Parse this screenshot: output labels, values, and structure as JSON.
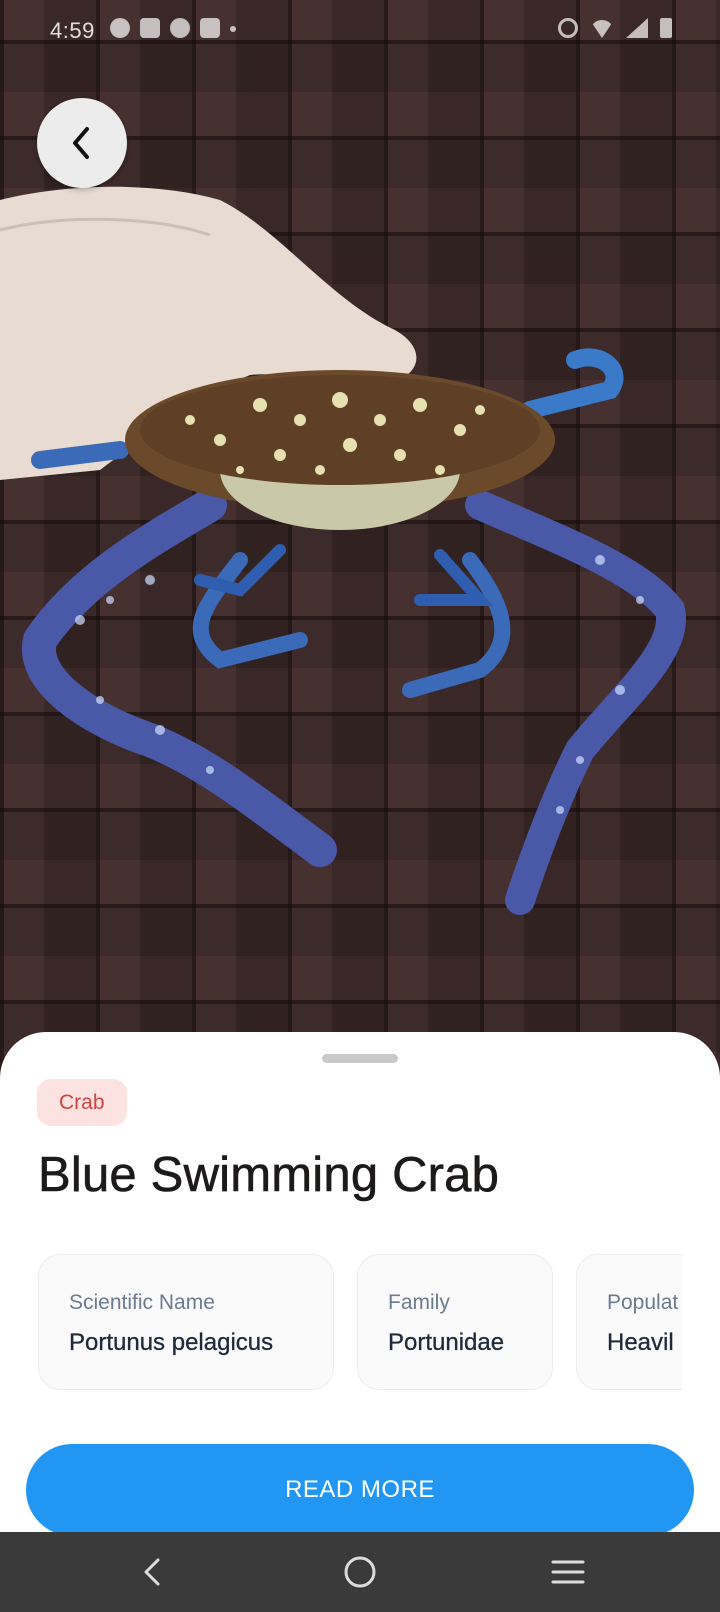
{
  "status_bar": {
    "time": "4:59"
  },
  "photo": {
    "subject": "blue swimming crab held in hand over tiled floor"
  },
  "back_button": {
    "icon": "chevron-left-icon"
  },
  "sheet": {
    "category_chip": "Crab",
    "title": "Blue Swimming Crab",
    "info_cards": [
      {
        "label": "Scientific Name",
        "value": "Portunus pelagicus"
      },
      {
        "label": "Family",
        "value": "Portunidae"
      },
      {
        "label": "Populat",
        "value": "Heavil"
      }
    ],
    "read_more_label": "READ MORE"
  },
  "nav_bar": {
    "back_icon": "nav-back-icon",
    "home_icon": "nav-home-icon",
    "recents_icon": "nav-recents-icon"
  },
  "colors": {
    "accent": "#2196f3",
    "chip_bg": "#fde2e2",
    "chip_text": "#d0453f",
    "title": "#1d1a1a",
    "card_label": "#6b7a8f",
    "nav_bar": "#3a3a3a"
  }
}
